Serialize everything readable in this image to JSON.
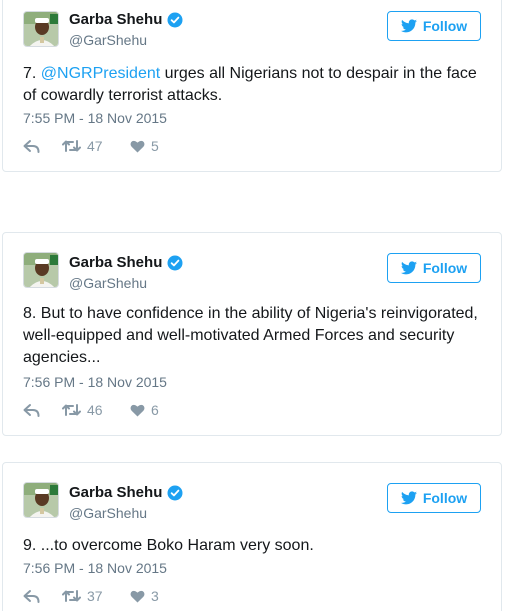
{
  "tweets": [
    {
      "author": {
        "name": "Garba Shehu",
        "handle": "@GarShehu"
      },
      "follow_label": "Follow",
      "number_prefix": "7. ",
      "mention": "@NGRPresident",
      "text": " urges all Nigerians not to despair in the face of cowardly terrorist attacks.",
      "timestamp": "7:55 PM - 18 Nov 2015",
      "retweets": "47",
      "likes": "5"
    },
    {
      "author": {
        "name": "Garba Shehu",
        "handle": "@GarShehu"
      },
      "follow_label": "Follow",
      "text": "8. But to have confidence in the ability of Nigeria's reinvigorated, well-equipped and well-motivated  Armed Forces and security agencies...",
      "timestamp": "7:56 PM - 18 Nov 2015",
      "retweets": "46",
      "likes": "6"
    },
    {
      "author": {
        "name": "Garba Shehu",
        "handle": "@GarShehu"
      },
      "follow_label": "Follow",
      "text": "9. ...to overcome Boko Haram very soon.",
      "timestamp": "7:56 PM - 18 Nov 2015",
      "retweets": "37",
      "likes": "3"
    }
  ],
  "icons": {
    "verified": "verified-badge-icon",
    "follow": "twitter-bird-icon",
    "reply": "reply-arrow-icon",
    "retweet": "retweet-icon",
    "like": "heart-icon"
  },
  "colors": {
    "accent": "#1da1f2",
    "text": "#14171a",
    "muted": "#657786",
    "action": "#8899a6",
    "border": "#e1e8ed"
  }
}
